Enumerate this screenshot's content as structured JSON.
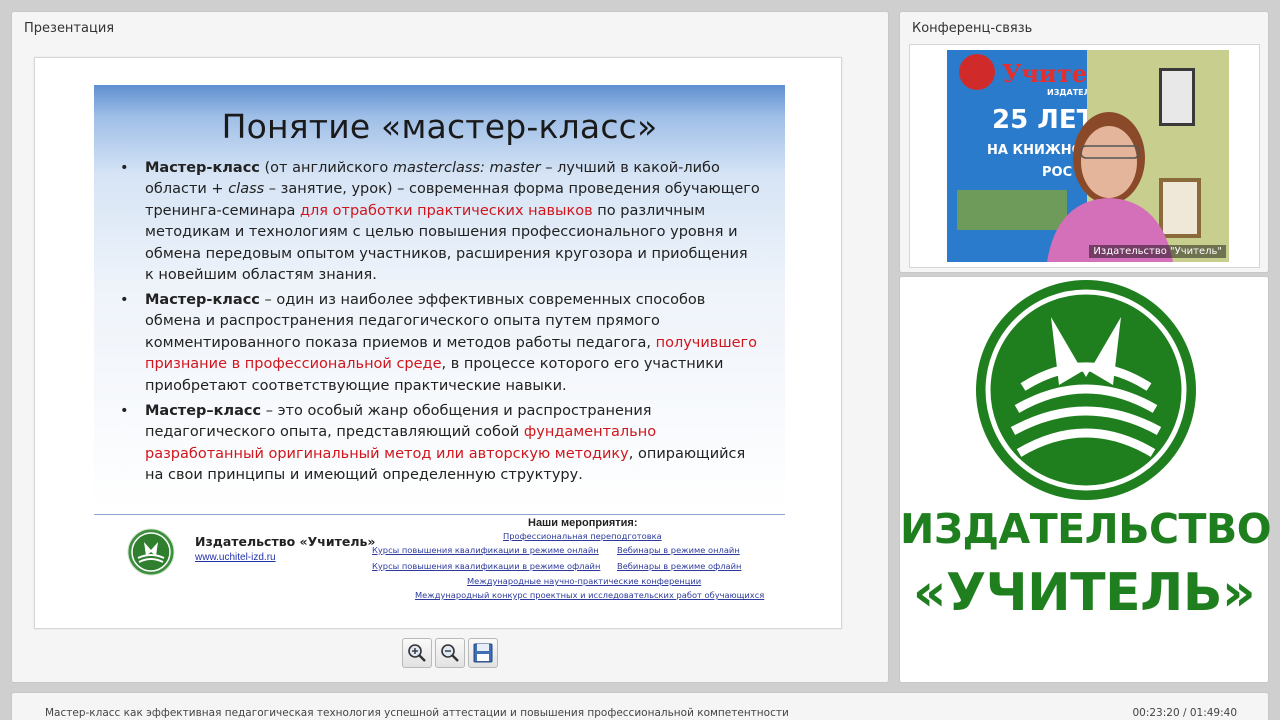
{
  "presentation": {
    "panel_title": "Презентация",
    "slide": {
      "title": "Понятие «мастер-класс»",
      "bullet_char": "•",
      "bullets": [
        {
          "term": "Мастер-класс",
          "t1": " (от английского ",
          "t1_italic": "masterclass: master",
          "t2": " – лучший в какой-либо области + ",
          "t2_italic": "class",
          "t3": " – занятие, урок) – современная форма проведения обучающего тренинга-семинара ",
          "red": "для отработки практических навыков",
          "t4": " по различным методикам и технологиям с целью повышения профессионального уровня и обмена передовым опытом участников, расширения кругозора и приобщения к новейшим областям знания."
        },
        {
          "term": "Мастер-класс",
          "t1": " – один из наиболее эффективных современных способов обмена и распространения педагогического опыта путем прямого комментированного показа приемов и методов работы педагога, ",
          "red": "получившего признание в профессиональной среде",
          "t2": ", в процессе которого его участники приобретают соответствующие практические навыки."
        },
        {
          "term": "Мастер–класс",
          "t1": " – это особый жанр обобщения и распространения педагогического опыта, представляющий собой ",
          "red": "фундаментально разработанный оригинальный метод или авторскую методику",
          "t2": ", опирающийся на свои принципы и имеющий определенную структуру."
        }
      ],
      "footer": {
        "publisher": "Издательство «Учитель»",
        "url": "www.uchitel-izd.ru",
        "events_title": "Наши мероприятия:",
        "events": [
          "Профессиональная переподготовка",
          "Курсы повышения квалификации в режиме онлайн",
          "Вебинары в режиме онлайн",
          "Курсы повышения квалификации в режиме офлайн",
          "Вебинары в режиме офлайн",
          "Международные научно-практические конференции",
          "Международный конкурс проектных и исследовательских работ обучающихся"
        ]
      }
    },
    "toolbar": {
      "zoom_in": "zoom-in",
      "zoom_out": "zoom-out",
      "save": "save"
    }
  },
  "conference": {
    "panel_title": "Конференц-связь",
    "video_label": "Издательство \"Учитель\"",
    "banner": {
      "brand": "Учитель",
      "sub": "ИЗДАТЕЛЬСТВО",
      "years": "25 ЛЕТ",
      "line": "НА КНИЖНОМ Р",
      "line2": "РОС"
    }
  },
  "brand": {
    "line1": "ИЗДАТЕЛЬСТВО",
    "line2": "«УЧИТЕЛЬ»",
    "color": "#1f7f1f"
  },
  "footer_bar": {
    "title": "Мастер-класс как эффективная педагогическая технология успешной аттестации и повышения профессиональной компетентности",
    "time": "00:23:20 / 01:49:40"
  }
}
